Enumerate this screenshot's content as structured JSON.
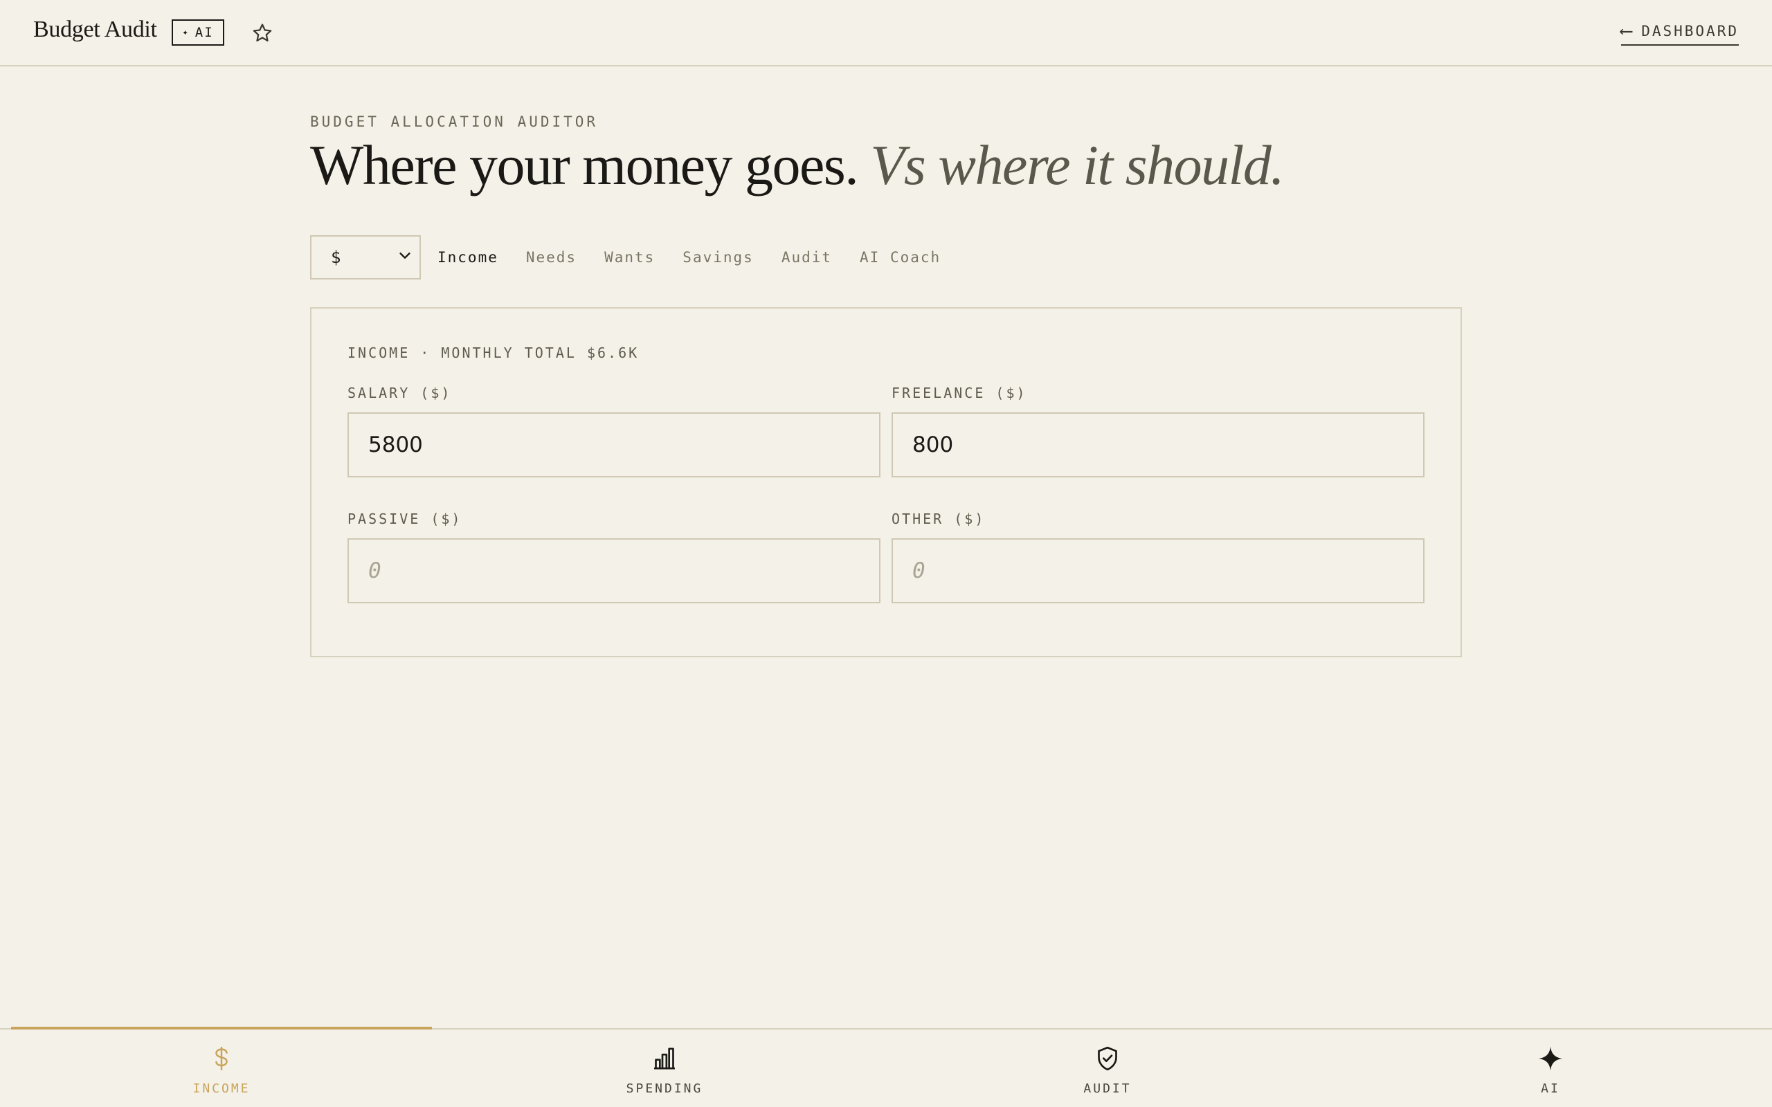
{
  "header": {
    "brand": "Budget Audit",
    "ai_badge": "AI",
    "dashboard_link": "DASHBOARD"
  },
  "hero": {
    "eyebrow": "BUDGET ALLOCATION AUDITOR",
    "title_main": "Where your money goes.",
    "title_alt": "Vs where it should."
  },
  "currency": {
    "selected": "$"
  },
  "tabs": [
    {
      "label": "Income",
      "active": true
    },
    {
      "label": "Needs",
      "active": false
    },
    {
      "label": "Wants",
      "active": false
    },
    {
      "label": "Savings",
      "active": false
    },
    {
      "label": "Audit",
      "active": false
    },
    {
      "label": "AI Coach",
      "active": false
    }
  ],
  "income_card": {
    "title": "INCOME · MONTHLY TOTAL $6.6K",
    "fields": {
      "salary": {
        "label": "SALARY ($)",
        "value": "5800",
        "placeholder": "0"
      },
      "freelance": {
        "label": "FREELANCE ($)",
        "value": "800",
        "placeholder": "0"
      },
      "passive": {
        "label": "PASSIVE ($)",
        "value": "",
        "placeholder": "0"
      },
      "other": {
        "label": "OTHER ($)",
        "value": "",
        "placeholder": "0"
      }
    }
  },
  "bottom_nav": {
    "items": [
      {
        "label": "INCOME",
        "icon": "dollar-icon",
        "active": true
      },
      {
        "label": "SPENDING",
        "icon": "bar-chart-icon",
        "active": false
      },
      {
        "label": "AUDIT",
        "icon": "shield-check-icon",
        "active": false
      },
      {
        "label": "AI",
        "icon": "sparkle-icon",
        "active": false
      }
    ]
  },
  "colors": {
    "background": "#f4f1e8",
    "text": "#1a1915",
    "muted": "#7a7666",
    "border": "#d6d1bd",
    "accent": "#c9a45c"
  }
}
